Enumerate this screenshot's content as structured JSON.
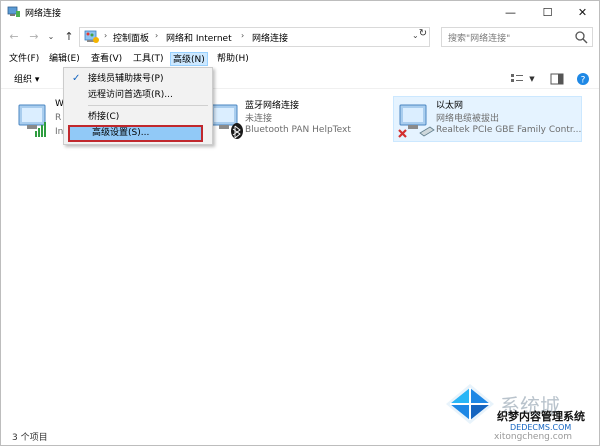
{
  "window": {
    "title": "网络连接",
    "minimize_glyph": "—",
    "maximize_glyph": "☐",
    "close_glyph": "✕"
  },
  "nav": {
    "back_glyph": "←",
    "forward_glyph": "→",
    "up_glyph": "↑",
    "breadcrumbs": [
      "控制面板",
      "网络和 Internet",
      "网络连接"
    ],
    "separator_glyph": "›",
    "refresh_glyph": "↻"
  },
  "search": {
    "placeholder": "搜索\"网络连接\""
  },
  "menubar": {
    "items": [
      "文件(F)",
      "编辑(E)",
      "查看(V)",
      "工具(T)",
      "高级(N)",
      "帮助(H)"
    ]
  },
  "toolbar": {
    "organize": "组织 ▾"
  },
  "menu": {
    "items": [
      "接线员辅助拨号(P)",
      "远程访问首选项(R)...",
      "桥接(C)",
      "高级设置(S)..."
    ],
    "checked_glyph": "✓"
  },
  "connections": [
    {
      "name_partial": "W",
      "status_partial": "R",
      "device_partial": "In"
    },
    {
      "name": "蓝牙网络连接",
      "status": "未连接",
      "device": "Bluetooth PAN HelpText"
    },
    {
      "name": "以太网",
      "status": "网络电缆被拔出",
      "device": "Realtek PCIe GBE Family Contr..."
    }
  ],
  "statusbar": {
    "count": "3 个项目"
  },
  "watermark": {
    "brand": "系统城",
    "site1": "织梦内容管理系统",
    "site2": "DEDECMS.COM",
    "site3": "xitongcheng.com"
  },
  "colors": {
    "accent": "#0078d7",
    "selected_bg": "#e5f3ff",
    "menu_highlight": "#91c9f7",
    "annotation_red": "#c0282d",
    "error_red": "#d32f2f"
  }
}
